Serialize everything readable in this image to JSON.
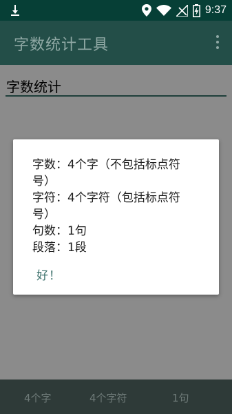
{
  "status_bar": {
    "time": "9:37",
    "icons": [
      "download-icon",
      "location-icon",
      "wifi-icon",
      "no-signal-icon",
      "battery-charging-icon"
    ]
  },
  "app_bar": {
    "title": "字数统计工具",
    "menu_icon": "more-vert-icon"
  },
  "input": {
    "value": "字数统计"
  },
  "dialog": {
    "lines": [
      "字数：4个字（不包括标点符",
      "号）",
      "字符：4个字符（包括标点符",
      "号）",
      "句数：1句",
      "段落：1段"
    ],
    "ok_label": "好！"
  },
  "bottom_bar": {
    "char_count": "4个字",
    "symbol_count": "4个字符",
    "sentence_count": "1句"
  },
  "colors": {
    "status_bar": "#063f36",
    "app_bar": "#234e48",
    "scrim": "#8a8a8a",
    "accent": "#3a6f6a"
  }
}
